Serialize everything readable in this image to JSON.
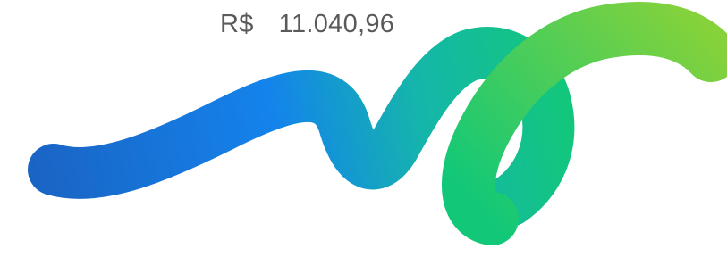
{
  "balance": {
    "currency_symbol": "R$",
    "amount": "11.040,96"
  },
  "graphic": {
    "name": "brand-wave",
    "colors": {
      "blue_dark": "#1a64c4",
      "blue": "#1483ec",
      "teal": "#15b6aa",
      "green": "#12c878",
      "lime": "#86d23a"
    }
  }
}
